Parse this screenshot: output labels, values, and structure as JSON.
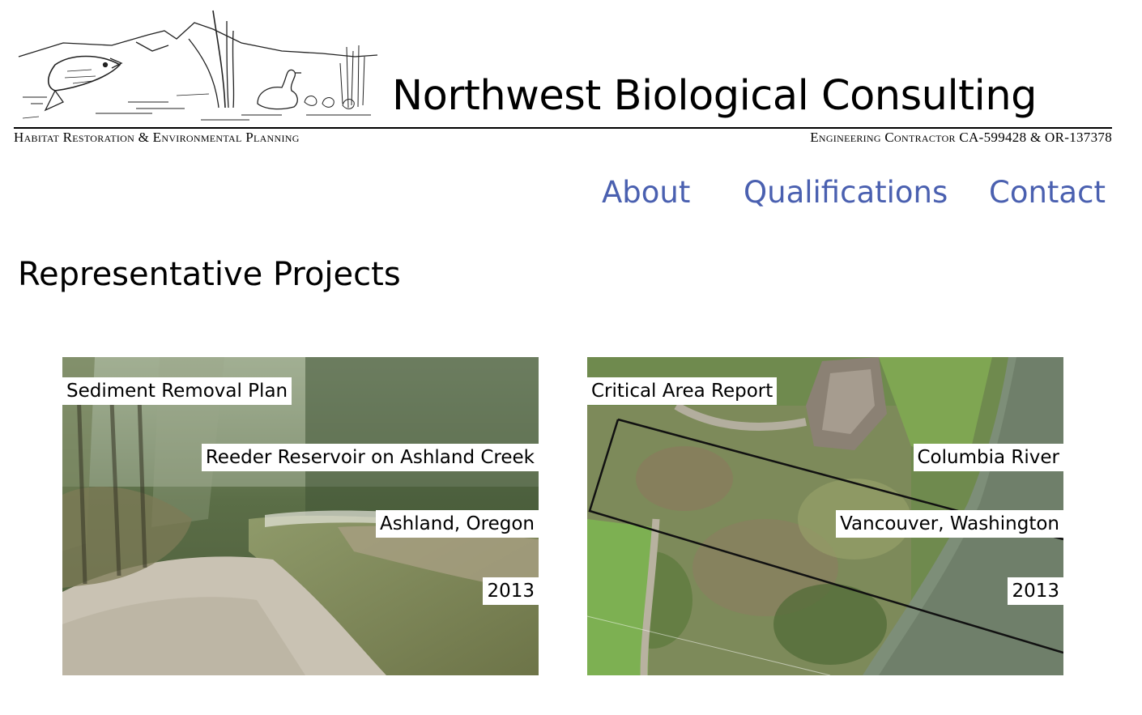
{
  "header": {
    "logo_icon": "fish-heron-marsh-sketch-icon",
    "title": "Northwest Biological Consulting",
    "tagline_left": "Habitat Restoration & Environmental Planning",
    "tagline_right": "Engineering Contractor CA-599428 & OR-137378"
  },
  "nav": {
    "about": "About",
    "qualifications": "Qualifications",
    "contact": "Contact",
    "link_color": "#4a60b0"
  },
  "main": {
    "heading": "Representative Projects",
    "projects": [
      {
        "title": "Sediment Removal Plan",
        "site": "Reeder Reservoir on Ashland Creek",
        "location": "Ashland, Oregon",
        "year": "2013",
        "image": "creek-photo"
      },
      {
        "title": "Critical Area Report",
        "site": "Columbia River",
        "location": "Vancouver, Washington",
        "year": "2013",
        "image": "aerial-map-photo"
      }
    ]
  }
}
